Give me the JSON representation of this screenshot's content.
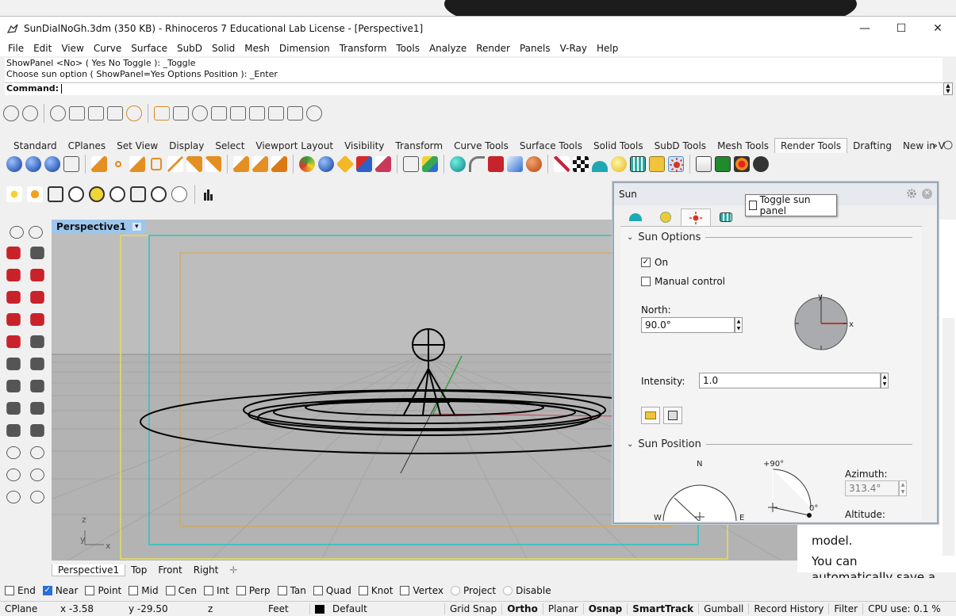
{
  "window": {
    "title": "SunDialNoGh.3dm (350 KB) - Rhinoceros 7 Educational Lab License - [Perspective1]",
    "minimize": "—",
    "maximize": "☐",
    "close": "✕"
  },
  "menu": [
    "File",
    "Edit",
    "View",
    "Curve",
    "Surface",
    "SubD",
    "Solid",
    "Mesh",
    "Dimension",
    "Transform",
    "Tools",
    "Analyze",
    "Render",
    "Panels",
    "V-Ray",
    "Help"
  ],
  "command": {
    "history_1": "ShowPanel <No> ( Yes  No  Toggle ): _Toggle",
    "history_2": "Choose sun option ( ShowPanel=Yes  Options  Position ): _Enter",
    "prompt": "Command:"
  },
  "toolbar_tabs": [
    "Standard",
    "CPlanes",
    "Set View",
    "Display",
    "Select",
    "Viewport Layout",
    "Visibility",
    "Transform",
    "Curve Tools",
    "Surface Tools",
    "Solid Tools",
    "SubD Tools",
    "Mesh Tools",
    "Render Tools",
    "Drafting",
    "New in V"
  ],
  "active_toolbar_tab": "Render Tools",
  "viewport": {
    "name": "Perspective1",
    "dropdown": "▾",
    "axis_z": "z",
    "axis_y": "y",
    "axis_x": "x"
  },
  "view_tabs": [
    "Perspective1",
    "Top",
    "Front",
    "Right"
  ],
  "view_tabs_add": "✛",
  "osnap": [
    {
      "label": "End",
      "checked": false
    },
    {
      "label": "Near",
      "checked": true
    },
    {
      "label": "Point",
      "checked": false
    },
    {
      "label": "Mid",
      "checked": false
    },
    {
      "label": "Cen",
      "checked": false
    },
    {
      "label": "Int",
      "checked": false
    },
    {
      "label": "Perp",
      "checked": false
    },
    {
      "label": "Tan",
      "checked": false
    },
    {
      "label": "Quad",
      "checked": false
    },
    {
      "label": "Knot",
      "checked": false
    },
    {
      "label": "Vertex",
      "checked": false
    },
    {
      "label": "Project",
      "checked": false
    },
    {
      "label": "Disable",
      "checked": false
    }
  ],
  "status": {
    "cplane": "CPlane",
    "x": "x -3.58",
    "y": "y -29.50",
    "z": "z",
    "units": "Feet",
    "layer": "Default",
    "grid_snap": "Grid Snap",
    "ortho": "Ortho",
    "planar": "Planar",
    "osnap": "Osnap",
    "smarttrack": "SmartTrack",
    "gumball": "Gumball",
    "record_history": "Record History",
    "filter": "Filter",
    "cpu": "CPU use: 0.1 %"
  },
  "tooltip": "Toggle sun panel",
  "sun_panel": {
    "title": "Sun",
    "sun_options": "Sun Options",
    "on_label": "On",
    "on_checked": true,
    "manual_label": "Manual control",
    "manual_checked": false,
    "north_label": "North:",
    "north_value": "90.0°",
    "compass_y": "y",
    "compass_x": "x",
    "intensity_label": "Intensity:",
    "intensity_value": "1.0",
    "sun_position": "Sun Position",
    "dial_n": "N",
    "dial_w": "W",
    "dial_e": "E",
    "alt_top": "+90°",
    "alt_zero": "0°",
    "azimuth_label": "Azimuth:",
    "azimuth_value": "313.4°",
    "altitude_label": "Altitude:"
  },
  "right_pane": {
    "line1": "model.",
    "line2": "You can",
    "line3": "automatically save a"
  },
  "colors": {
    "viewport_bg": "#b9b9b9",
    "viewport_tab": "#9ec6ec",
    "cplane_cyan": "#22c4c4",
    "frame_orange": "#d9a542",
    "frame_yellow": "#e5de5a",
    "north_red": "#c0392b"
  }
}
